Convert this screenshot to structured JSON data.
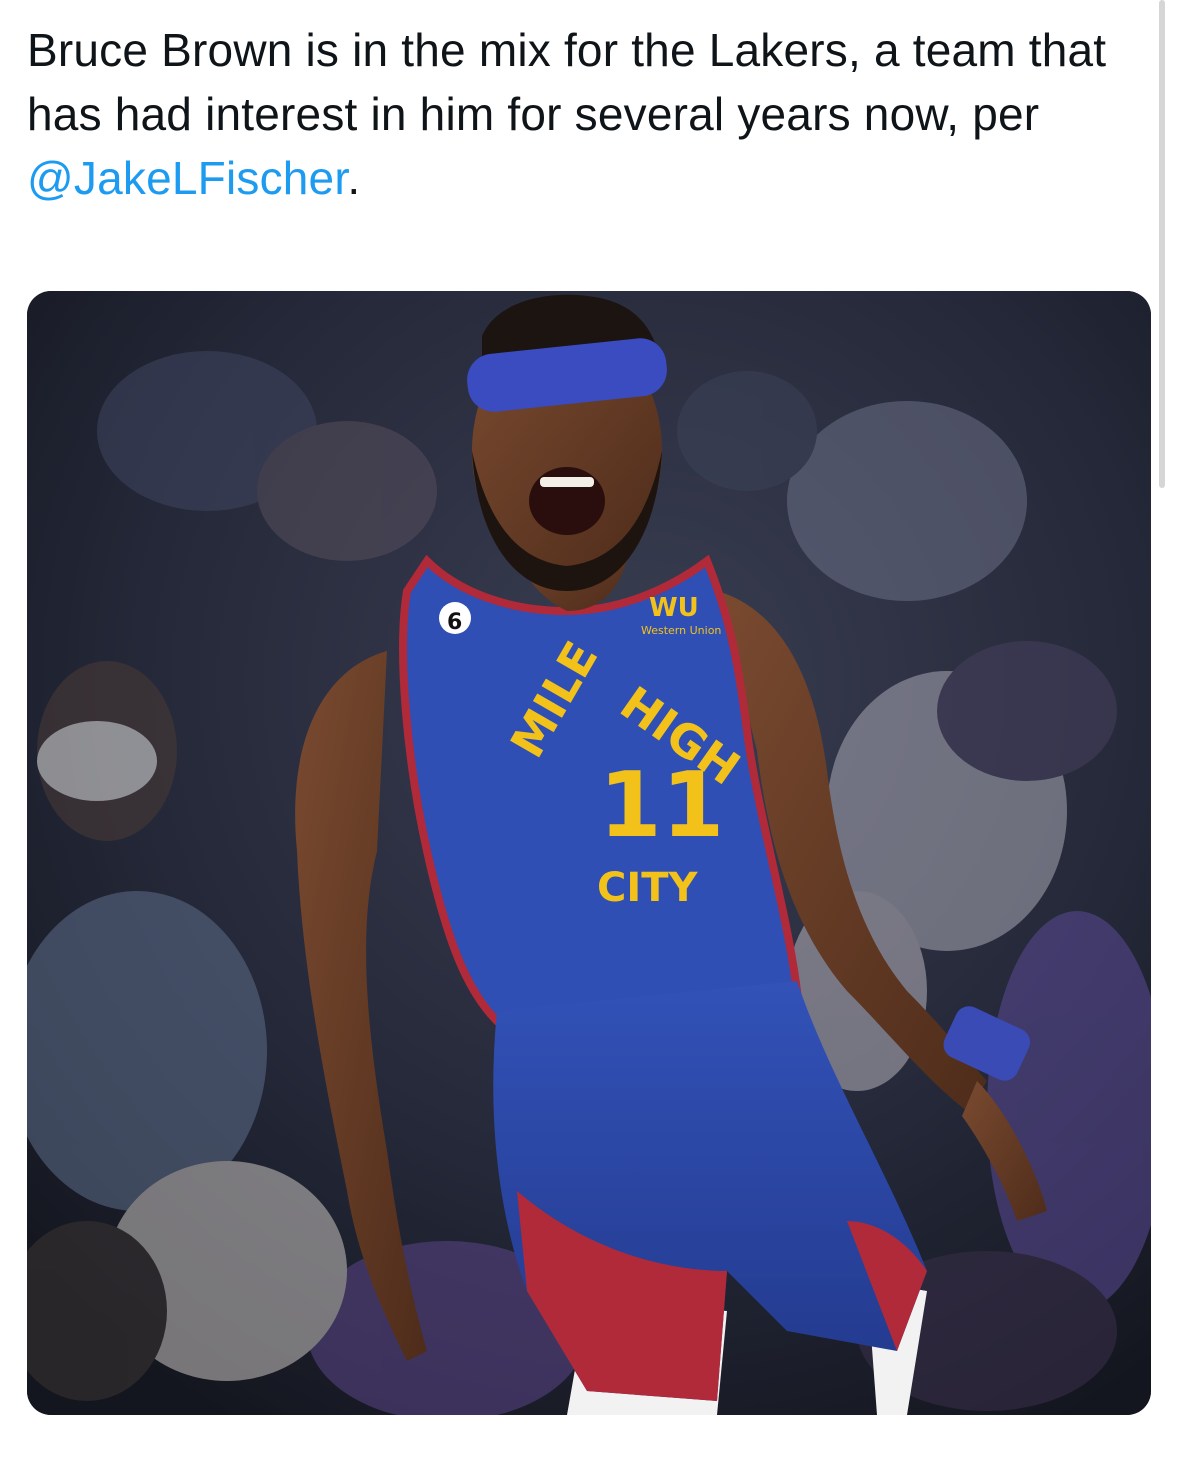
{
  "tweet": {
    "text_before": "Bruce Brown is in the mix for the Lakers, a team that has had interest in him for several years now, per ",
    "mention": "@JakeLFischer",
    "text_after": "."
  },
  "media": {
    "alt": "Photo of a Denver Nuggets player shouting in celebration, wearing a blue Mile High City jersey number 11",
    "jersey": {
      "top_text_left": "MILE",
      "top_text_right": "HIGH",
      "number": "11",
      "bottom_text": "CITY",
      "patch_number": "6",
      "sponsor_logo": "WU",
      "sponsor_name": "Western Union"
    },
    "colors": {
      "jersey_blue": "#2f4fb5",
      "jersey_red": "#b02a3a",
      "jersey_gold": "#f2c21a"
    }
  }
}
